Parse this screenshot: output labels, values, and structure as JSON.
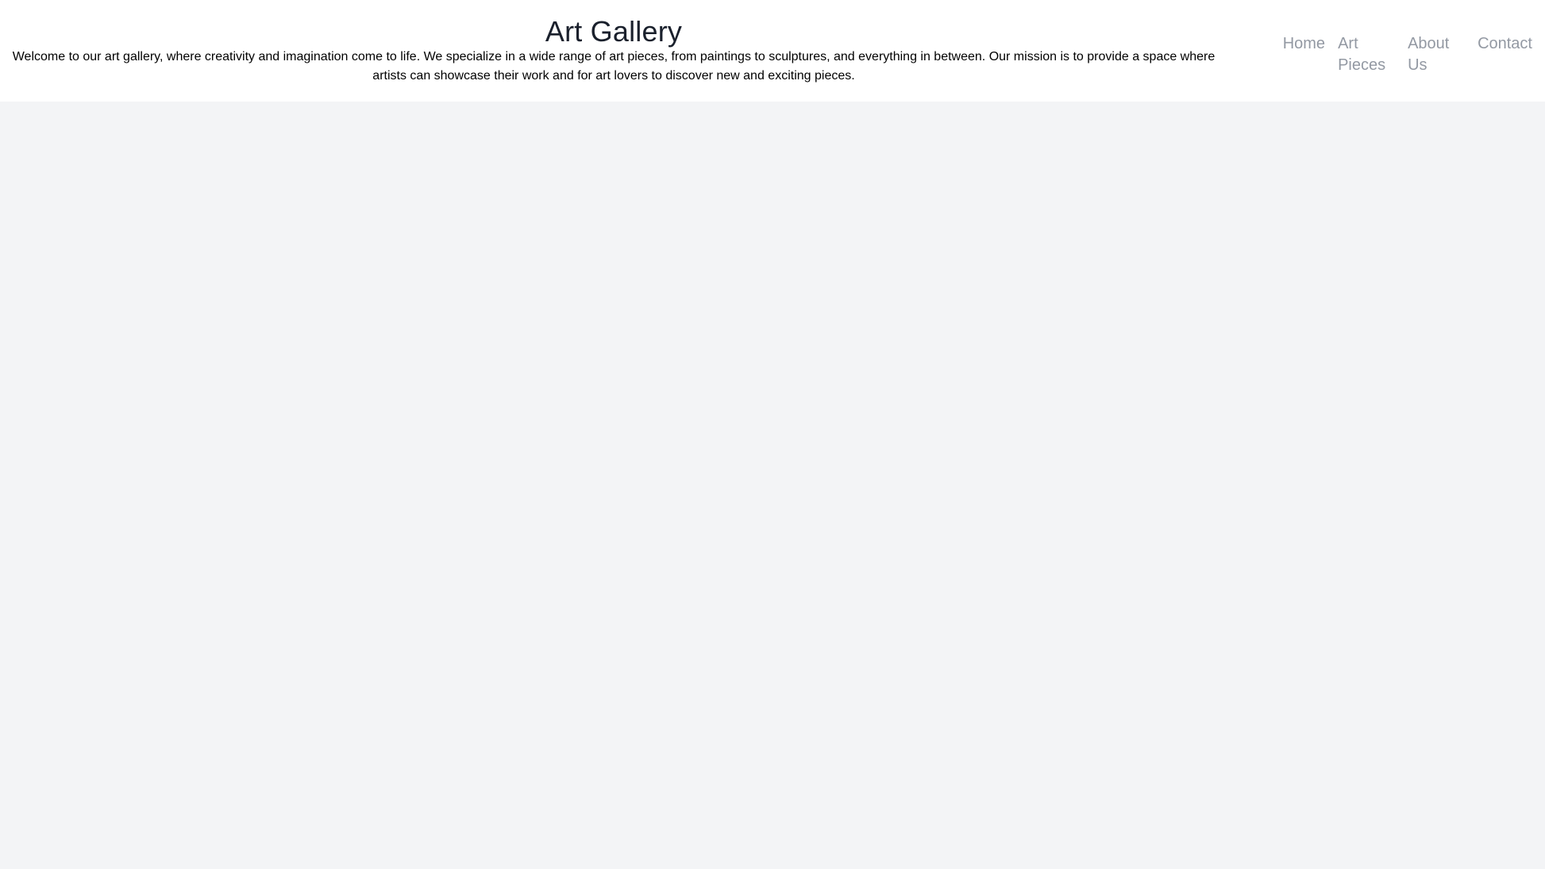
{
  "page": {
    "background_color": "#f3f4f6",
    "header_background_color": "#ffffff"
  },
  "header": {
    "title": "Art Gallery",
    "tagline": "Welcome to our art gallery, where creativity and imagination come to life. We specialize in a wide range of art pieces, from paintings to sculptures, and everything in between. Our mission is to provide a space where artists can showcase their work and for art lovers to discover new and exciting pieces.",
    "title_color": "#1a202c",
    "tagline_color": "#000000"
  },
  "nav": {
    "link_color": "#9399a3",
    "items": [
      {
        "label": "Home"
      },
      {
        "label": "Art Pieces"
      },
      {
        "label": "About Us"
      },
      {
        "label": "Contact"
      }
    ]
  },
  "main": {
    "content": ""
  }
}
